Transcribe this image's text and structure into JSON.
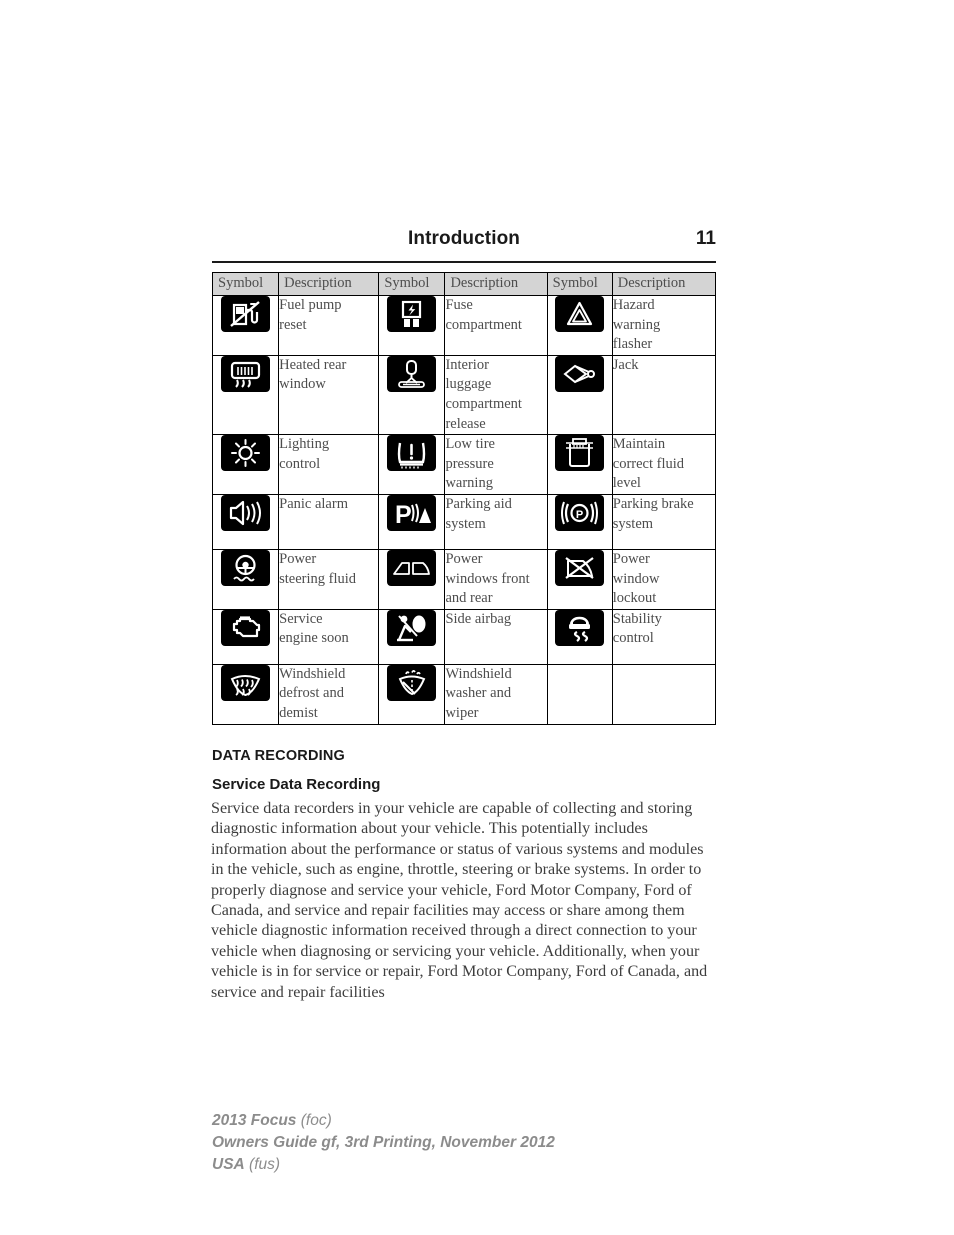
{
  "header": {
    "title": "Introduction",
    "page_number": "11"
  },
  "table": {
    "columns": [
      "Symbol",
      "Description",
      "Symbol",
      "Description",
      "Symbol",
      "Description"
    ],
    "rows": [
      [
        {
          "icon": "fuel-pump-reset-icon",
          "label": "Fuel pump\nreset"
        },
        {
          "icon": "fuse-compartment-icon",
          "label": "Fuse\ncompartment"
        },
        {
          "icon": "hazard-warning-flasher-icon",
          "label": "Hazard\nwarning\nflasher"
        }
      ],
      [
        {
          "icon": "heated-rear-window-icon",
          "label": "Heated rear\nwindow"
        },
        {
          "icon": "interior-luggage-compartment-release-icon",
          "label": "Interior\nluggage\ncompartment\nrelease"
        },
        {
          "icon": "jack-icon",
          "label": "Jack"
        }
      ],
      [
        {
          "icon": "lighting-control-icon",
          "label": "Lighting\ncontrol"
        },
        {
          "icon": "low-tire-pressure-warning-icon",
          "label": "Low tire\npressure\nwarning"
        },
        {
          "icon": "maintain-correct-fluid-level-icon",
          "label": "Maintain\ncorrect fluid\nlevel"
        }
      ],
      [
        {
          "icon": "panic-alarm-icon",
          "label": "Panic alarm"
        },
        {
          "icon": "parking-aid-system-icon",
          "label": "Parking aid\nsystem"
        },
        {
          "icon": "parking-brake-system-icon",
          "label": "Parking brake\nsystem"
        }
      ],
      [
        {
          "icon": "power-steering-fluid-icon",
          "label": "Power\nsteering fluid"
        },
        {
          "icon": "power-windows-front-and-rear-icon",
          "label": "Power\nwindows front\nand rear"
        },
        {
          "icon": "power-window-lockout-icon",
          "label": "Power\nwindow\nlockout"
        }
      ],
      [
        {
          "icon": "service-engine-soon-icon",
          "label": "Service\nengine soon"
        },
        {
          "icon": "side-airbag-icon",
          "label": "Side airbag"
        },
        {
          "icon": "stability-control-icon",
          "label": "Stability\ncontrol"
        }
      ],
      [
        {
          "icon": "windshield-defrost-and-demist-icon",
          "label": "Windshield\ndefrost and\ndemist"
        },
        {
          "icon": "windshield-washer-and-wiper-icon",
          "label": "Windshield\nwasher and\nwiper"
        },
        {
          "icon": "",
          "label": ""
        }
      ]
    ]
  },
  "content": {
    "section_heading": "DATA RECORDING",
    "sub_heading": "Service Data Recording",
    "paragraph": "Service data recorders in your vehicle are capable of collecting and storing diagnostic information about your vehicle. This potentially includes information about the performance or status of various systems and modules in the vehicle, such as engine, throttle, steering or brake systems. In order to properly diagnose and service your vehicle, Ford Motor Company, Ford of Canada, and service and repair facilities may access or share among them vehicle diagnostic information received through a direct connection to your vehicle when diagnosing or servicing your vehicle. Additionally, when your vehicle is in for service or repair, Ford Motor Company, Ford of Canada, and service and repair facilities"
  },
  "footer": {
    "line1_bold": "2013 Focus",
    "line1_light": "(foc)",
    "line2_bold": "Owners Guide gf, 3rd Printing, November 2012",
    "line3_bold": "USA",
    "line3_light": "(fus)"
  },
  "colors": {
    "header_row_bg": "#d4d4d4",
    "icon_bg": "#000000",
    "text": "#4d4d4d",
    "footer_text": "#8c8c8c"
  }
}
